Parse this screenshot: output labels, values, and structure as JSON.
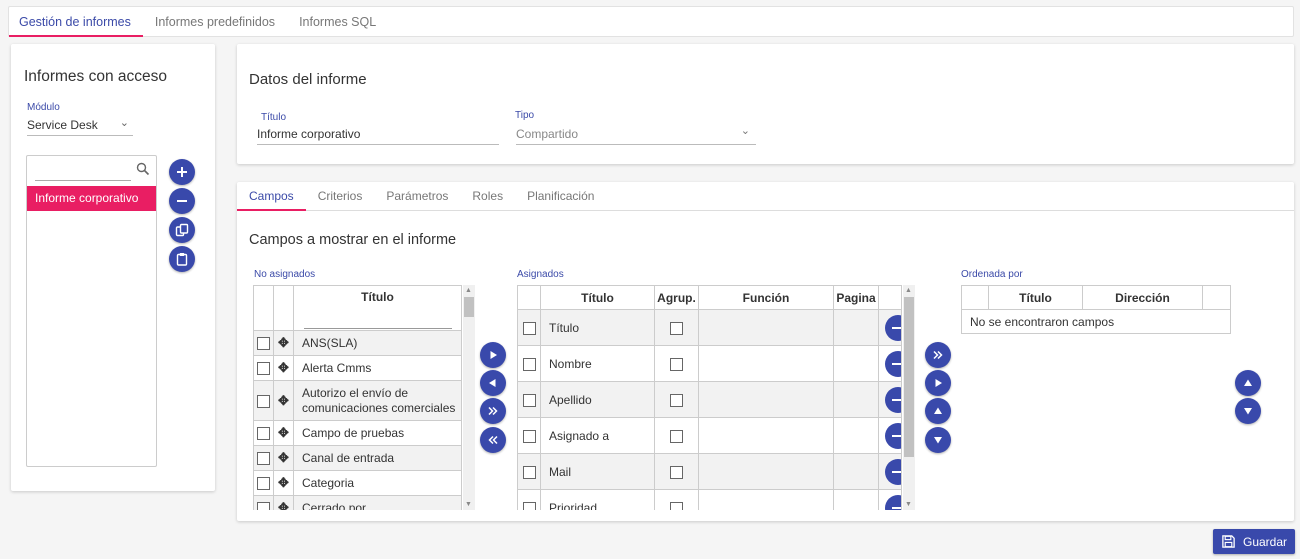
{
  "top_tabs": [
    {
      "label": "Gestión de informes",
      "active": true
    },
    {
      "label": "Informes predefinidos",
      "active": false
    },
    {
      "label": "Informes SQL",
      "active": false
    }
  ],
  "left_panel": {
    "title": "Informes con acceso",
    "module_label": "Módulo",
    "module_value": "Service Desk",
    "search_placeholder": "",
    "reports": [
      {
        "label": "Informe corporativo",
        "selected": true
      }
    ],
    "actions": [
      "add-icon",
      "remove-icon",
      "copy-icon",
      "paste-icon"
    ]
  },
  "report_data": {
    "title": "Datos del informe",
    "title_field_label": "Título",
    "title_field_value": "Informe corporativo",
    "type_field_label": "Tipo",
    "type_field_value": "Compartido"
  },
  "inner_tabs": [
    {
      "label": "Campos",
      "active": true
    },
    {
      "label": "Criterios",
      "active": false
    },
    {
      "label": "Parámetros",
      "active": false
    },
    {
      "label": "Roles",
      "active": false
    },
    {
      "label": "Planificación",
      "active": false
    }
  ],
  "fields": {
    "section_title": "Campos a mostrar en el informe",
    "unassigned": {
      "label": "No asignados",
      "column_title": "Título",
      "filter_value": "",
      "rows": [
        "ANS(SLA)",
        "Alerta Cmms",
        "Autorizo el envío de comunicaciones comerciales",
        "Campo de pruebas",
        "Canal de entrada",
        "Categoria",
        "Cerrado por"
      ]
    },
    "transfer_buttons": [
      "move-right-icon",
      "move-left-icon",
      "move-all-right-icon",
      "move-all-left-icon"
    ],
    "assigned": {
      "label": "Asignados",
      "columns": [
        "Título",
        "Agrup.",
        "Función",
        "Pagina"
      ],
      "rows": [
        {
          "title": "Título",
          "function": "",
          "page": ""
        },
        {
          "title": "Nombre",
          "function": "",
          "page": ""
        },
        {
          "title": "Apellido",
          "function": "",
          "page": ""
        },
        {
          "title": "Asignado a",
          "function": "",
          "page": ""
        },
        {
          "title": "Mail",
          "function": "",
          "page": ""
        },
        {
          "title": "Prioridad",
          "function": "",
          "page": ""
        }
      ]
    },
    "order_buttons": [
      "move-all-right-icon",
      "move-right-icon",
      "move-up-icon",
      "move-down-icon"
    ],
    "ordered_by": {
      "label": "Ordenada por",
      "columns": [
        "Título",
        "Dirección"
      ],
      "empty_message": "No se encontraron campos"
    },
    "sort_buttons": [
      "move-up-icon",
      "move-down-icon"
    ]
  },
  "save_label": "Guardar",
  "colors": {
    "primary": "#3949ab",
    "accent": "#e91e63"
  }
}
